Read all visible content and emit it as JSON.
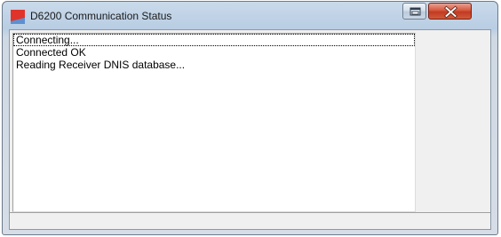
{
  "window": {
    "title": "D6200 Communication Status",
    "icon": "app-logo-icon"
  },
  "title_buttons": {
    "restore_icon": "restore-icon",
    "close_icon": "close-icon"
  },
  "log": {
    "items": [
      "Connecting...",
      "Connected OK",
      "Reading Receiver DNIS database..."
    ]
  },
  "status_bar": {
    "text": ""
  },
  "colors": {
    "close_button": "#c8422a",
    "title_bar": "#bcd0e5"
  }
}
